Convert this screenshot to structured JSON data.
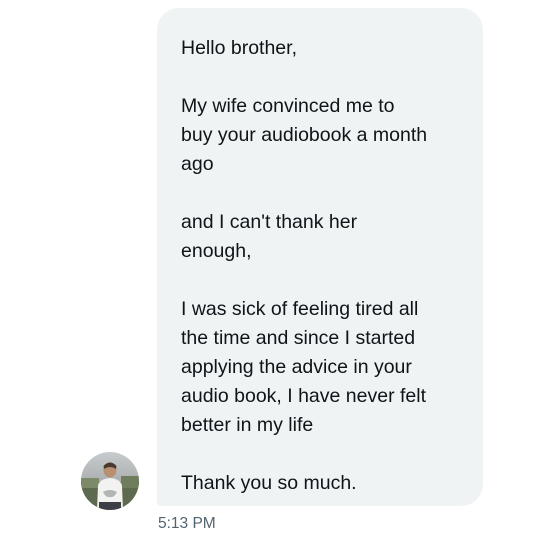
{
  "message": {
    "paragraphs": [
      "Hello brother,",
      "My wife convinced me to\nbuy your audiobook a month\nago",
      "and I can't thank her\nenough,",
      "I was sick of feeling tired all\nthe time and since I started\napplying the advice in your\naudio book, I have never felt\nbetter in my life",
      "Thank you so much."
    ],
    "timestamp": "5:13 PM"
  },
  "colors": {
    "bubble_bg": "#eff3f4",
    "text": "#0f1419",
    "timestamp": "#536471"
  },
  "icons": {
    "avatar": "profile-photo"
  }
}
